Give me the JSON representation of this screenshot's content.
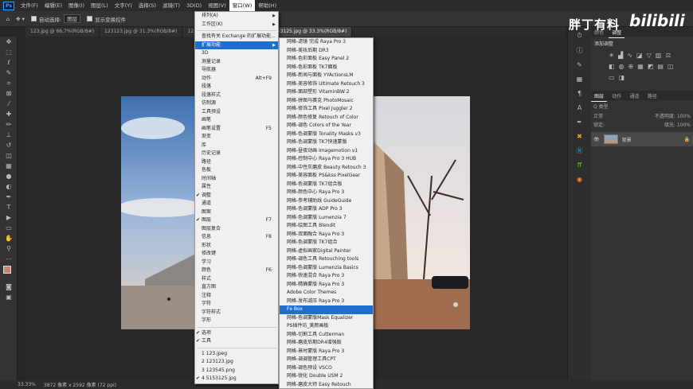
{
  "app": {
    "logo": "Ps"
  },
  "menubar": [
    "文件(F)",
    "编辑(E)",
    "图像(I)",
    "图层(L)",
    "文字(Y)",
    "选择(S)",
    "滤镜(T)",
    "3D(D)",
    "视图(V)",
    "窗口(W)",
    "帮助(H)"
  ],
  "menubar_active_index": 9,
  "options": {
    "auto_select": "自动选择:",
    "auto_select_value": "图层",
    "show_transform": "显示变换控件"
  },
  "tabs": [
    "123.jpg @ 66.7%(RGB/8#)",
    "123123.jpg @ 31.3%(RGB/8#)",
    "123545.png @ 100%(RGB/8#)",
    "5153125.jpg @ 33.3%(RGB/8#)"
  ],
  "active_tab": 3,
  "window_menu": [
    {
      "label": "排列(A)",
      "arrow": true
    },
    {
      "label": "工作区(K)",
      "arrow": true
    },
    {
      "sep": true
    },
    {
      "label": "查找有关 Exchange 的扩展功能..."
    },
    {
      "label": "扩展功能",
      "arrow": true,
      "highlight": true
    },
    {
      "label": "3D"
    },
    {
      "label": "测量记录"
    },
    {
      "label": "导航器"
    },
    {
      "label": "动作",
      "shortcut": "Alt+F9"
    },
    {
      "label": "段落"
    },
    {
      "label": "段落样式"
    },
    {
      "label": "仿制源"
    },
    {
      "label": "工具预设"
    },
    {
      "label": "画笔"
    },
    {
      "label": "画笔设置",
      "shortcut": "F5"
    },
    {
      "label": "渐变"
    },
    {
      "label": "库"
    },
    {
      "label": "历史记录"
    },
    {
      "label": "路径"
    },
    {
      "label": "色板"
    },
    {
      "label": "时间轴"
    },
    {
      "label": "属性"
    },
    {
      "label": "调整",
      "checked": true
    },
    {
      "label": "通道"
    },
    {
      "label": "图案"
    },
    {
      "label": "图层",
      "shortcut": "F7",
      "checked": true
    },
    {
      "label": "图层复合"
    },
    {
      "label": "信息",
      "shortcut": "F8"
    },
    {
      "label": "形状"
    },
    {
      "label": "修改键"
    },
    {
      "label": "学习"
    },
    {
      "label": "颜色",
      "shortcut": "F6"
    },
    {
      "label": "样式"
    },
    {
      "label": "直方图"
    },
    {
      "label": "注释"
    },
    {
      "label": "字符"
    },
    {
      "label": "字符样式"
    },
    {
      "label": "字形"
    },
    {
      "sep": true
    },
    {
      "label": "选项",
      "checked": true
    },
    {
      "label": "工具",
      "checked": true
    },
    {
      "sep": true
    },
    {
      "label": "1 123.jpeg"
    },
    {
      "label": "2 123123.jpg"
    },
    {
      "label": "3 123545.png"
    },
    {
      "label": "4 5153125.jpg",
      "checked": true
    }
  ],
  "extensions_submenu": [
    "网格-滤镜 完成 Raya Pro 3",
    "网格-美妆后期 DR3",
    "网格-色彩面板 Easy Panel 2",
    "网格-色彩面板 TK7面板",
    "网格-新闻与面板 YYActionsLM",
    "网格-美容修饰 Ultimate Retouch 3",
    "网格-面部塑形 VitaminBW 2",
    "网格-拼图马赛克 PhotoMosaic",
    "网格-修饰工具 Pixel Juggler 2",
    "网格-颜色修复 Retouch of Color",
    "网格-调色 Colors of the Year",
    "网格-色调蒙版 Tonality Masks v3",
    "网格-色调蒙版 TK7快速蒙版",
    "网格-昼夜动画 Imagemotion v1",
    "网格-控制中心 Raya Pro 3 HUB",
    "网格-中性灰磨皮 Beauty Retouch 3",
    "网格-美容面板 PS&kss PixelGear",
    "网格-色调蒙版 TK7组合板",
    "网格-颜色中心 Raya Pro 3",
    "网格-参考辅助线 GuideGuide",
    "网格-色调蒙版 ADP Pro 3",
    "网格-色调蒙版 Lumenzia 7",
    "网格-绘图工具 Blendit",
    "网格-双面融合 Raya Pro 3",
    "网格-色调蒙版 TK7组合",
    "网格-虚拟画家Digital Painter",
    "网格-调色工具 Retouching tools",
    "网格-色调蒙版 Lumenzia Basics",
    "网格-快速混合 Raya Pro 3",
    "网格-精确蒙版 Raya Pro 3",
    "Adobe Color Themes",
    "网格-发布减压 Raya Pro 3",
    "Fx Box",
    "网格-色调蒙版Mask Equalizer",
    "PS插件坊_美颜画板",
    "网格-切割工具 Cutterman",
    "网格-磨皮后期DR4增强版",
    "网格-景时蒙版 Raya Pro 3",
    "网格-调调管理工具CPT",
    "网格-调色预设 VSCO",
    "网格-锐化 Double USM 2",
    "网格-磨皮大师 Easy Retouch"
  ],
  "submenu_highlight_index": 32,
  "status": {
    "zoom": "33.33%",
    "doc_size": "3872 像素 x 2592 像素 (72 ppi)"
  },
  "watermark": {
    "text": "胖丁有料",
    "site": "bilibili"
  },
  "panel": {
    "top_tabs": [
      "颜色",
      "调整"
    ],
    "adjust_title": "添加调整",
    "layer_tabs": [
      "图层",
      "动作",
      "通道",
      "路径"
    ],
    "kind_label": "Q 类型",
    "blend_mode": "正常",
    "opacity_label": "不透明度:",
    "opacity": "100%",
    "lock_label": "锁定:",
    "fill_label": "填充:",
    "fill": "100%",
    "layer_name": "背景"
  },
  "colors": {
    "highlight": "#1f6fd1",
    "foreground": "#c8836a"
  }
}
